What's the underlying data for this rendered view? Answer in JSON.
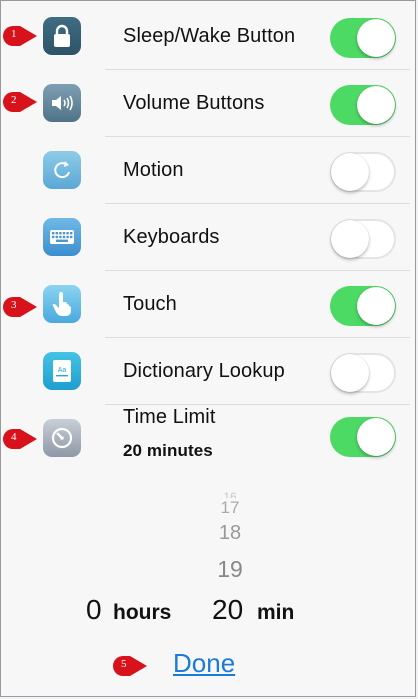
{
  "rows": [
    {
      "label": "Sleep/Wake Button",
      "icon": "lock-icon",
      "toggle": "on",
      "marker": "1"
    },
    {
      "label": "Volume Buttons",
      "icon": "speaker-icon",
      "toggle": "on",
      "marker": "2"
    },
    {
      "label": "Motion",
      "icon": "rotate-icon",
      "toggle": "off",
      "marker": ""
    },
    {
      "label": "Keyboards",
      "icon": "keyboard-icon",
      "toggle": "off",
      "marker": ""
    },
    {
      "label": "Touch",
      "icon": "hand-icon",
      "toggle": "on",
      "marker": "3"
    },
    {
      "label": "Dictionary Lookup",
      "icon": "dictionary-icon",
      "toggle": "off",
      "marker": ""
    }
  ],
  "time_limit": {
    "label": "Time Limit",
    "value": "20 minutes",
    "icon": "timer-icon",
    "toggle": "on",
    "marker": "4"
  },
  "picker": {
    "values": [
      "16",
      "17",
      "18",
      "19"
    ]
  },
  "duration": {
    "hours_value": "0",
    "hours_unit": "hours",
    "min_value": "20",
    "min_unit": "min"
  },
  "done": {
    "label": "Done",
    "marker": "5"
  },
  "colors": {
    "toggle_on": "#4cd964",
    "marker_red": "#d8121a",
    "link_blue": "#1a7bdb"
  }
}
